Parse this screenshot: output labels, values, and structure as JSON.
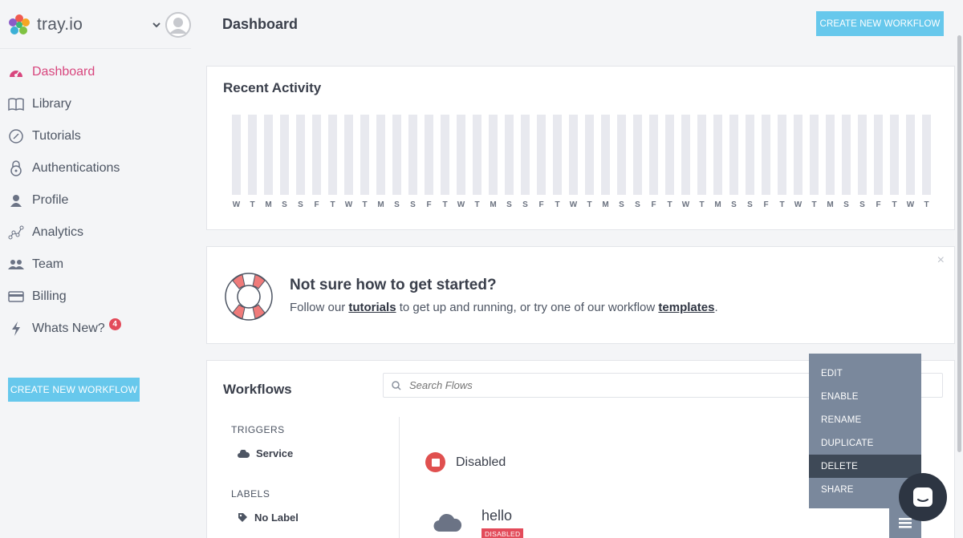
{
  "brand": {
    "name": "tray.io"
  },
  "header": {
    "title": "Dashboard",
    "create_button": "CREATE NEW WORKFLOW"
  },
  "sidebar": {
    "items": [
      {
        "label": "Dashboard",
        "icon": "dashboard-icon",
        "active": true
      },
      {
        "label": "Library",
        "icon": "book-icon"
      },
      {
        "label": "Tutorials",
        "icon": "compass-icon"
      },
      {
        "label": "Authentications",
        "icon": "lock-icon"
      },
      {
        "label": "Profile",
        "icon": "user-icon"
      },
      {
        "label": "Analytics",
        "icon": "analytics-icon"
      },
      {
        "label": "Team",
        "icon": "team-icon"
      },
      {
        "label": "Billing",
        "icon": "credit-card-icon"
      },
      {
        "label": "Whats New?",
        "icon": "lightning-icon",
        "badge": "4"
      }
    ],
    "create_button": "CREATE NEW WORKFLOW"
  },
  "recent_activity": {
    "title": "Recent Activity",
    "days": [
      "W",
      "T",
      "M",
      "S",
      "S",
      "F",
      "T",
      "W",
      "T",
      "M",
      "S",
      "S",
      "F",
      "T",
      "W",
      "T",
      "M",
      "S",
      "S",
      "F",
      "T",
      "W",
      "T",
      "M",
      "S",
      "S",
      "F",
      "T",
      "W",
      "T",
      "M",
      "S",
      "S",
      "F",
      "T",
      "W",
      "T",
      "M",
      "S",
      "S",
      "F",
      "T",
      "W",
      "T"
    ]
  },
  "getting_started": {
    "heading": "Not sure how to get started?",
    "text_before": "Follow our ",
    "link1": "tutorials",
    "text_middle": " to get up and running, or try one of our workflow ",
    "link2": "templates",
    "text_after": ".",
    "close": "×"
  },
  "workflows": {
    "title": "Workflows",
    "search_placeholder": "Search Flows",
    "triggers_heading": "TRIGGERS",
    "trigger_item": "Service",
    "labels_heading": "LABELS",
    "label_item": "No Label",
    "status_label": "Disabled",
    "flow": {
      "name": "hello",
      "badge": "DISABLED"
    }
  },
  "context_menu": {
    "items": [
      "EDIT",
      "ENABLE",
      "RENAME",
      "DUPLICATE",
      "DELETE",
      "SHARE"
    ],
    "highlighted": "DELETE"
  },
  "colors": {
    "accent": "#67c8ec",
    "active_nav": "#d8467e",
    "danger": "#e34b5a",
    "menu_bg": "#7a889c"
  }
}
